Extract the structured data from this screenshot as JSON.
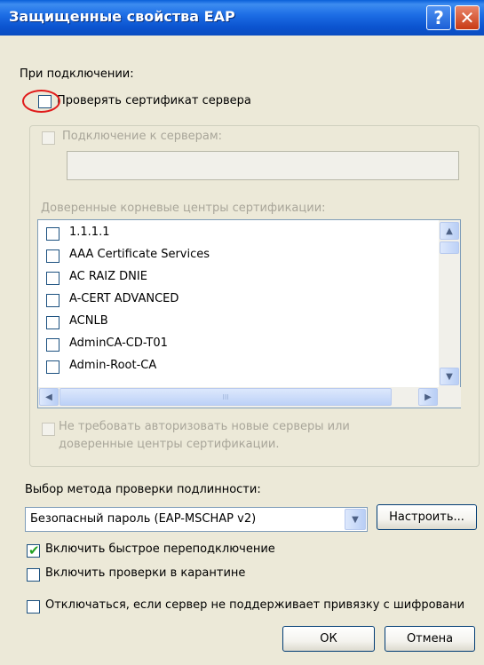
{
  "window": {
    "title": "Защищенные свойства EAP",
    "help_label": "?",
    "close_label": "✕"
  },
  "connect_section": {
    "label": "При подключении:",
    "verify_cert": {
      "label": "Проверять сертификат сервера",
      "checked": false
    }
  },
  "connect_to_servers": {
    "label": "Подключение к серверам:",
    "value": "",
    "enabled": false
  },
  "trusted_ca": {
    "label": "Доверенные корневые центры сертификации:",
    "items": [
      {
        "label": "1.1.1.1",
        "checked": false
      },
      {
        "label": "AAA Certificate Services",
        "checked": false
      },
      {
        "label": "AC RAIZ DNIE",
        "checked": false
      },
      {
        "label": "A-CERT ADVANCED",
        "checked": false
      },
      {
        "label": "ACNLB",
        "checked": false
      },
      {
        "label": "AdminCA-CD-T01",
        "checked": false
      },
      {
        "label": "Admin-Root-CA",
        "checked": false
      }
    ]
  },
  "no_prompt": {
    "line1": "Не требовать авторизовать новые серверы или",
    "line2": "доверенные центры сертификации.",
    "enabled": false
  },
  "auth_method": {
    "label": "Выбор метода проверки подлинности:",
    "selected": "Безопасный пароль (EAP-MSCHAP v2)",
    "configure_label": "Настроить..."
  },
  "options": {
    "fast_reconnect": {
      "label": "Включить быстрое переподключение",
      "checked": true
    },
    "quarantine": {
      "label": "Включить проверки в карантине",
      "checked": false
    },
    "disconnect": {
      "label": "Отключаться, если сервер не поддерживает привязку с шифровани",
      "checked": false
    }
  },
  "buttons": {
    "ok": "ОК",
    "cancel": "Отмена"
  },
  "icons": {
    "scroll_up": "▲",
    "scroll_down": "▼",
    "scroll_left": "◀",
    "scroll_right": "▶",
    "combo_arrow": "▼",
    "grip": "III",
    "check": "✔"
  },
  "colors": {
    "titlebar": "#0b54d0",
    "dialog_bg": "#ece9d8",
    "annotation_red": "#e01b1b",
    "check_green": "#21a121"
  }
}
